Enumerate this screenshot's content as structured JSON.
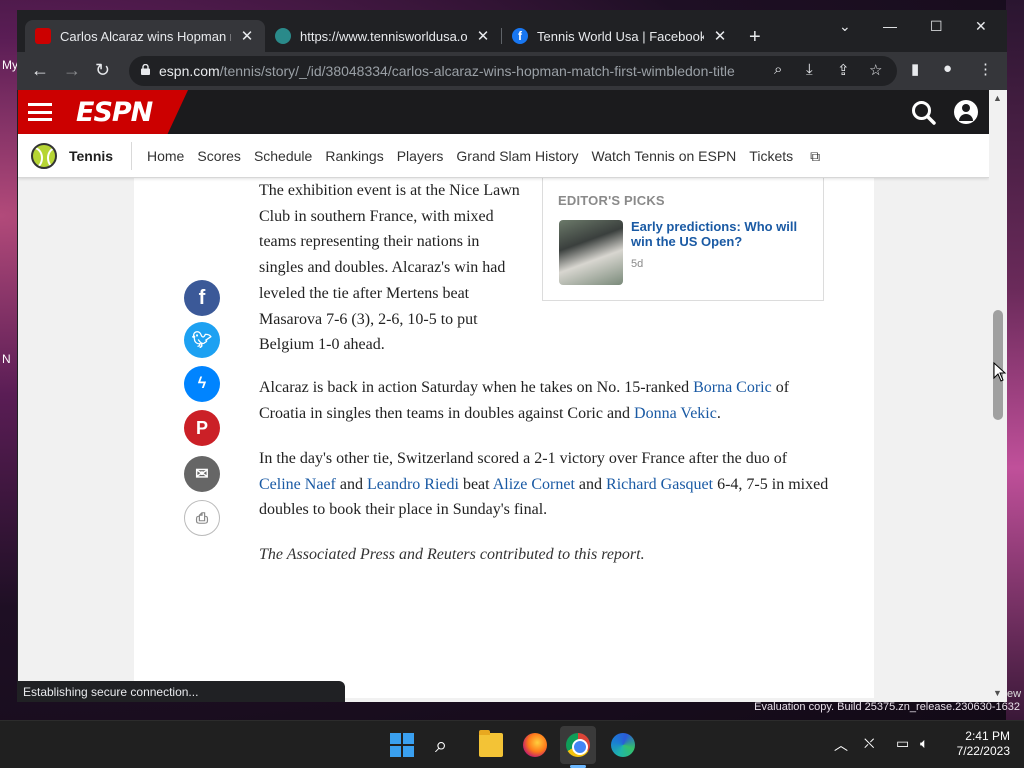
{
  "desktop": {
    "label_1": "My",
    "label_2": "N",
    "eval_text": "Evaluation copy. Build 25375.zn_release.230630-1632",
    "edge_text": "ew"
  },
  "browser": {
    "tabs": [
      {
        "title": "Carlos Alcaraz wins Hopman match",
        "favicon_color": "#cc0000"
      },
      {
        "title": "https://www.tennisworldusa.org/",
        "favicon_color": "#2a8a8a"
      },
      {
        "title": "Tennis World Usa | Facebook",
        "favicon_color": "#1877f2"
      }
    ],
    "url_host": "espn.com",
    "url_path": "/tennis/story/_/id/38048334/carlos-alcaraz-wins-hopman-match-first-wimbledon-title",
    "status_text": "Establishing secure connection..."
  },
  "espn": {
    "logo": "ESPN",
    "sport": "Tennis",
    "nav": [
      "Home",
      "Scores",
      "Schedule",
      "Rankings",
      "Players",
      "Grand Slam History",
      "Watch Tennis on ESPN",
      "Tickets"
    ],
    "brand_red": "#cc0000",
    "link_blue": "#1a5aa4"
  },
  "article": {
    "p1": "The exhibition event is at the Nice Lawn Club in southern France, with mixed teams representing their nations in singles and doubles. Alcaraz's win had leveled the tie after Mertens beat Masarova 7-6 (3), 2-6, 10-5 to put Belgium 1-0 ahead.",
    "p2_a": "Alcaraz is back in action Saturday when he takes on No. 15-ranked ",
    "p2_link1": "Borna Coric",
    "p2_b": " of Croatia in singles then teams in doubles against Coric and ",
    "p2_link2": "Donna Vekic",
    "p2_c": ".",
    "p3_a": "In the day's other tie, Switzerland scored a 2-1 victory over France after the duo of ",
    "p3_link1": "Celine Naef",
    "p3_b": " and ",
    "p3_link2": "Leandro Riedi",
    "p3_c": " beat ",
    "p3_link3": "Alize Cornet",
    "p3_d": " and ",
    "p3_link4": "Richard Gasquet",
    "p3_e": " 6-4, 7-5 in mixed doubles to book their place in Sunday's final.",
    "p4": "The Associated Press and Reuters contributed to this report."
  },
  "editors_picks": {
    "heading": "EDITOR'S PICKS",
    "title": "Early predictions: Who will win the US Open?",
    "age": "5d"
  },
  "share_icons": [
    "facebook-icon",
    "twitter-icon",
    "messenger-icon",
    "pinterest-icon",
    "email-icon",
    "print-icon"
  ],
  "taskbar": {
    "time": "2:41 PM",
    "date": "7/22/2023"
  }
}
